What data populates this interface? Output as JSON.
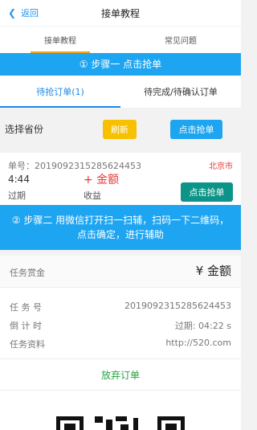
{
  "header": {
    "back_label": "返回",
    "title": "接单教程"
  },
  "top_tabs": [
    {
      "label": "接单教程",
      "active": true
    },
    {
      "label": "常见问题",
      "active": false
    }
  ],
  "step1": {
    "text": "① 步骤一 点击抢单"
  },
  "order_tabs": [
    {
      "label": "待抢订单(1)",
      "active": true
    },
    {
      "label": "待完成/待确认订单",
      "active": false
    }
  ],
  "province": {
    "label": "选择省份",
    "refresh_label": "刷新",
    "grab_label": "点击抢单"
  },
  "order": {
    "order_no": "单号：2019092315285624453",
    "city": "北京市",
    "time": "4:44",
    "amount": "+ 金额",
    "status": "过期",
    "income_label": "收益",
    "grab_label": "点击抢单"
  },
  "step2": {
    "text": "② 步骤二 用微信打开扫一扫辅，扫码一下二维码，点击确定，进行辅助"
  },
  "task": {
    "reward_label": "任务赏金",
    "reward_value": "¥ 金额",
    "task_no_label": "任 务 号",
    "task_no_value": "2019092315285624453",
    "countdown_label": "倒 计 时",
    "countdown_value": "过期: 04:22 s",
    "material_label": "任务资料",
    "material_value": "http://520.com",
    "abandon_label": "放弃订单"
  },
  "colors": {
    "accent_blue": "#1ea5f1",
    "refresh_yellow": "#f7c000",
    "grab_green": "#0d9488",
    "alert_red": "#e53935",
    "abandon_green": "#22a33c",
    "tab_underline": "#f7a600"
  }
}
